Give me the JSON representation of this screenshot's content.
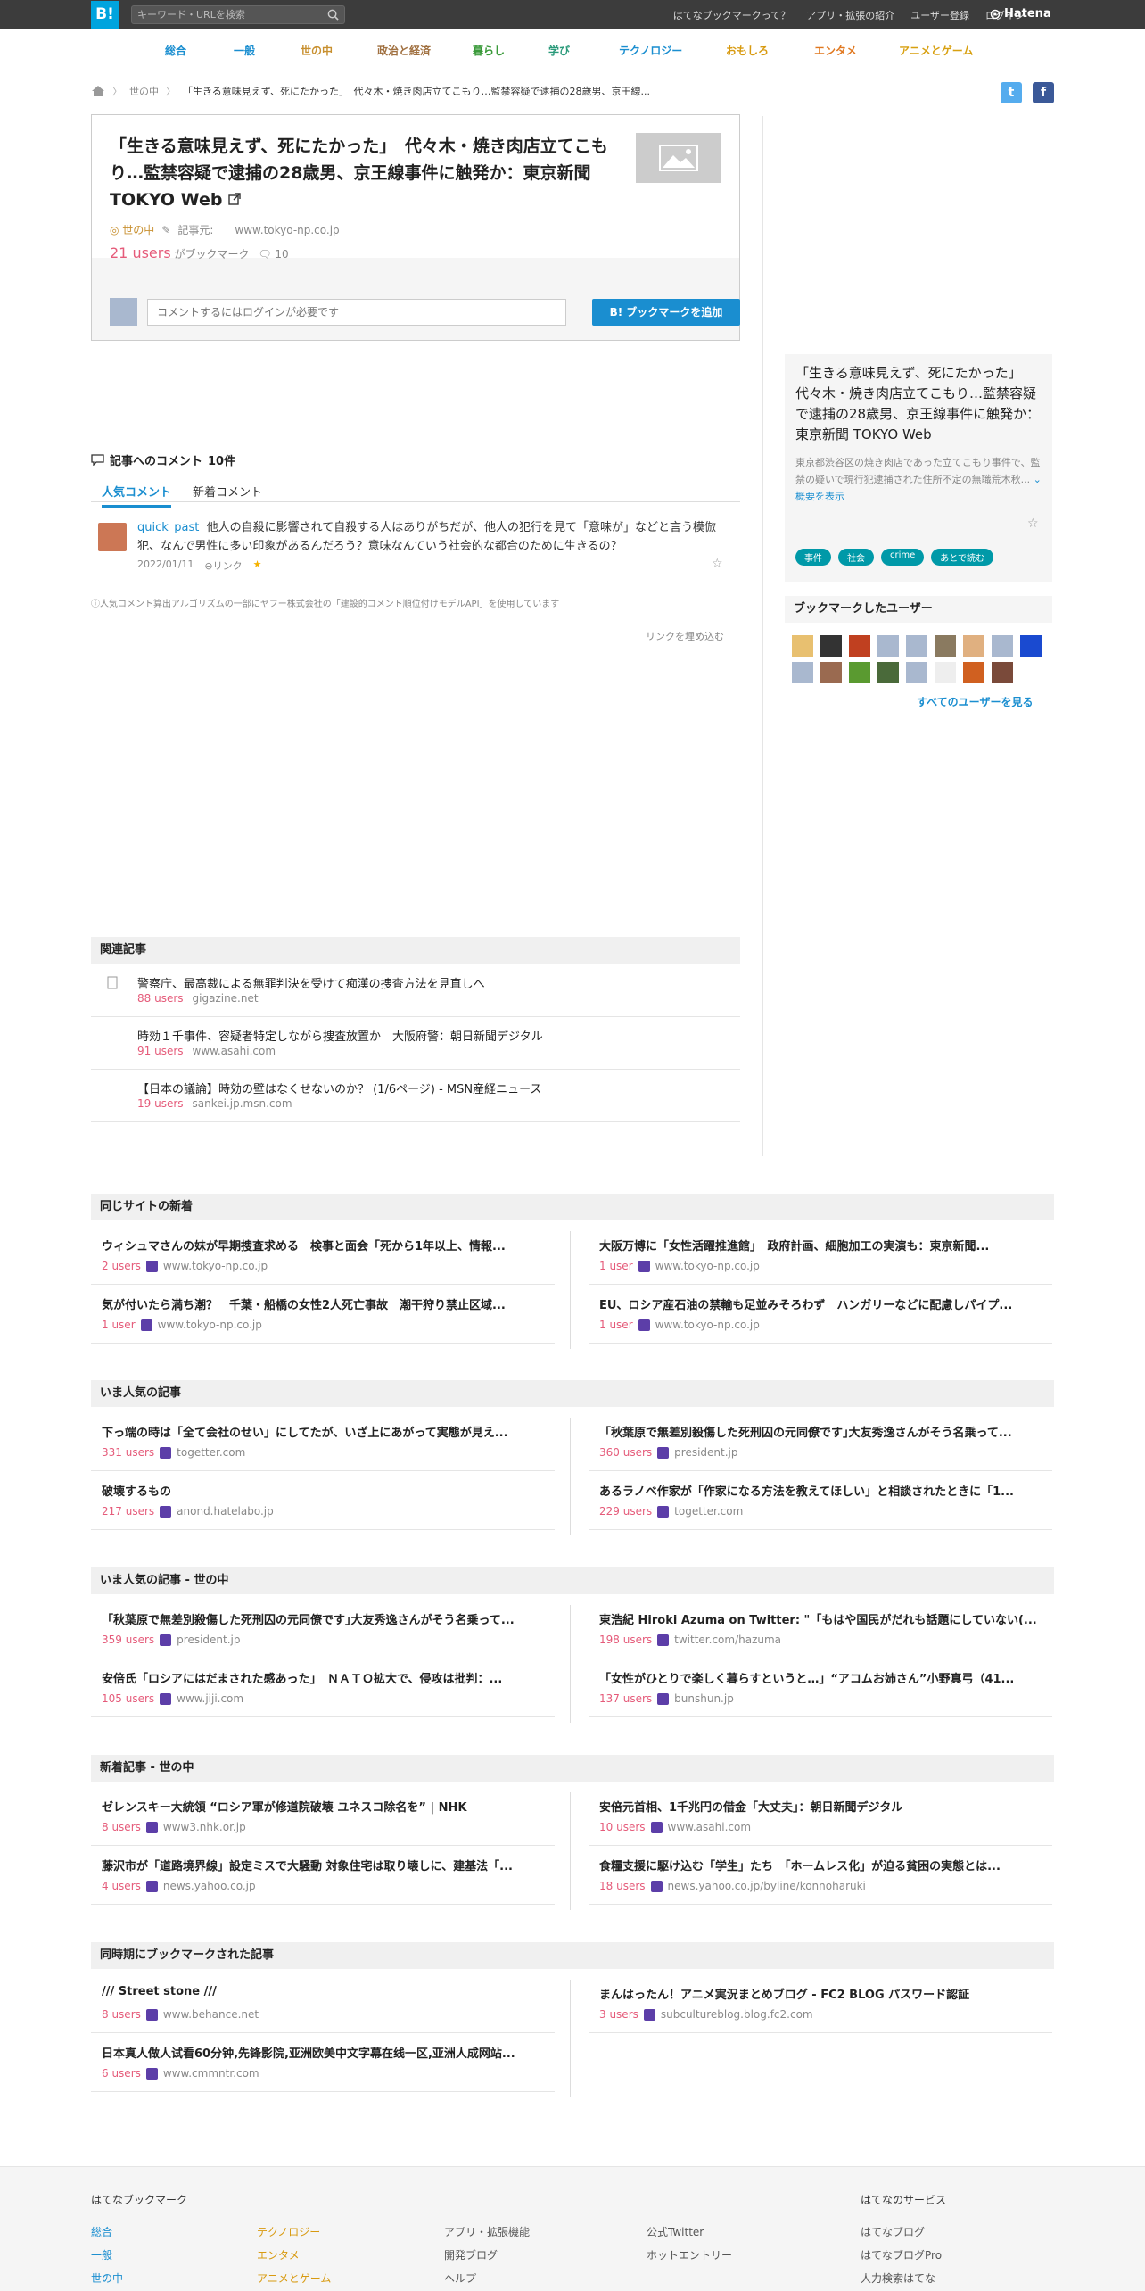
{
  "header": {
    "logo": "B!",
    "search_placeholder": "キーワード・URLを検索",
    "nav": [
      "はてなブックマークって？",
      "アプリ・拡張の紹介",
      "ユーザー登録",
      "ログイン"
    ],
    "hatena": "Hatena"
  },
  "categories": [
    {
      "label": "総合",
      "color": "#1a8ed0"
    },
    {
      "label": "一般",
      "color": "#1a8ed0"
    },
    {
      "label": "世の中",
      "color": "#c89030"
    },
    {
      "label": "政治と経済",
      "color": "#a07040"
    },
    {
      "label": "暮らし",
      "color": "#3a9a3a"
    },
    {
      "label": "学び",
      "color": "#2a9a7a"
    },
    {
      "label": "テクノロジー",
      "color": "#1a8ed0"
    },
    {
      "label": "おもしろ",
      "color": "#d89a10"
    },
    {
      "label": "エンタメ",
      "color": "#e07820"
    },
    {
      "label": "アニメとゲーム",
      "color": "#d8a010"
    }
  ],
  "breadcrumb": {
    "category": "世の中",
    "current": "「生きる意味見えず、死にたかった」　代々木・焼き肉店立てこもり…監禁容疑で逮捕の28歳男、京王線..."
  },
  "entry": {
    "title": "「生きる意味見えず、死にたかった」　代々木・焼き肉店立てこもり…監禁容疑で逮捕の28歳男、京王線事件に触発か：東京新聞 TOKYO Web",
    "category": "世の中",
    "kiji_label": "記事元:",
    "domain": "www.tokyo-np.co.jp",
    "users_count": "21 users",
    "users_suffix": "がブックマーク",
    "comment_count": "10",
    "comment_placeholder": "コメントするにはログインが必要です",
    "add_button": "ブックマークを追加"
  },
  "sidebar": {
    "summary_title": "「生きる意味見えず、死にたかった」　代々木・焼き肉店立てこもり…監禁容疑で逮捕の28歳男、京王線事件に触発か：東京新聞 TOKYO Web",
    "summary_desc": "東京都渋谷区の焼き肉店であった立てこもり事件で、監禁の疑いで現行犯逮捕された住所不定の無職荒木秋...",
    "show_summary": "概要を表示",
    "tags": [
      "事件",
      "社会",
      "crime",
      "あとで読む"
    ],
    "bookmark_users_title": "ブックマークしたユーザー",
    "all_users": "すべてのユーザーを見る"
  },
  "comments": {
    "heading": "記事へのコメント",
    "count": "10件",
    "tab_popular": "人気コメント",
    "tab_new": "新着コメント",
    "items": [
      {
        "user": "quick_past",
        "text": "他人の自殺に影響されて自殺する人はありがちだが、他人の犯行を見て「意味が」などと言う模倣犯、なんで男性に多い印象があるんだろう？意味なんていう社会的な都合のために生きるの？",
        "date": "2022/01/11",
        "link": "リンク"
      }
    ],
    "note": "人気コメント算出アルゴリズムの一部にヤフー株式会社の「建設的コメント順位付けモデルAPI」を使用しています",
    "embed": "リンクを埋め込む"
  },
  "related": {
    "title": "関連記事",
    "items": [
      {
        "title": "警察庁、最高裁による無罪判決を受けて痴漢の捜査方法を見直しへ",
        "users": "88 users",
        "domain": "gigazine.net"
      },
      {
        "title": "時効１千事件、容疑者特定しながら捜査放置か　大阪府警：朝日新聞デジタル",
        "users": "91 users",
        "domain": "www.asahi.com"
      },
      {
        "title": "【日本の議論】時効の壁はなくせないのか？ (1/6ページ) - MSN産経ニュース",
        "users": "19 users",
        "domain": "sankei.jp.msn.com"
      }
    ]
  },
  "sections": [
    {
      "title": "同じサイトの新着",
      "items": [
        {
          "title": "ウィシュマさんの妹が早期捜査求める　検事と面会「死から1年以上、情報...",
          "users": "2 users",
          "domain": "www.tokyo-np.co.jp"
        },
        {
          "title": "大阪万博に「女性活躍推進館」　政府計画、細胞加工の実演も：東京新聞...",
          "users": "1 user",
          "domain": "www.tokyo-np.co.jp"
        },
        {
          "title": "気が付いたら満ち潮？　千葉・船橋の女性2人死亡事故　潮干狩り禁止区域...",
          "users": "1 user",
          "domain": "www.tokyo-np.co.jp"
        },
        {
          "title": "EU、ロシア産石油の禁輸も足並みそろわず　ハンガリーなどに配慮しパイプ...",
          "users": "1 user",
          "domain": "www.tokyo-np.co.jp"
        }
      ]
    },
    {
      "title": "いま人気の記事",
      "items": [
        {
          "title": "下っ端の時は「全て会社のせい」にしてたが、いざ上にあがって実態が見え...",
          "users": "331 users",
          "domain": "togetter.com"
        },
        {
          "title": "「秋葉原で無差別殺傷した死刑囚の元同僚です｣大友秀逸さんがそう名乗って...",
          "users": "360 users",
          "domain": "president.jp"
        },
        {
          "title": "破壊するもの",
          "users": "217 users",
          "domain": "anond.hatelabo.jp"
        },
        {
          "title": "あるラノベ作家が「作家になる方法を教えてほしい」と相談されたときに「1...",
          "users": "229 users",
          "domain": "togetter.com"
        }
      ]
    },
    {
      "title": "いま人気の記事 - 世の中",
      "items": [
        {
          "title": "「秋葉原で無差別殺傷した死刑囚の元同僚です｣大友秀逸さんがそう名乗って...",
          "users": "359 users",
          "domain": "president.jp"
        },
        {
          "title": "東浩紀 Hiroki Azuma on Twitter: \"「もはや国民がだれも話題にしていない(...",
          "users": "198 users",
          "domain": "twitter.com/hazuma"
        },
        {
          "title": "安倍氏「ロシアにはだまされた感あった」　ＮＡＴＯ拡大で、侵攻は批判：...",
          "users": "105 users",
          "domain": "www.jiji.com"
        },
        {
          "title": "「女性がひとりで楽しく暮らすというと…」“アコムお姉さん”小野真弓（41...",
          "users": "137 users",
          "domain": "bunshun.jp"
        }
      ]
    },
    {
      "title": "新着記事 - 世の中",
      "items": [
        {
          "title": "ゼレンスキー大統領 “ロシア軍が修道院破壊 ユネスコ除名を” | NHK",
          "users": "8 users",
          "domain": "www3.nhk.or.jp"
        },
        {
          "title": "安倍元首相、1千兆円の借金「大丈夫」：朝日新聞デジタル",
          "users": "10 users",
          "domain": "www.asahi.com"
        },
        {
          "title": "藤沢市が「道路境界線」設定ミスで大騒動 対象住宅は取り壊しに、建基法「...",
          "users": "4 users",
          "domain": "news.yahoo.co.jp"
        },
        {
          "title": "食糧支援に駆け込む「学生」たち　「ホームレス化」が迫る貧困の実態とは...",
          "users": "18 users",
          "domain": "news.yahoo.co.jp/byline/konnoharuki"
        }
      ]
    },
    {
      "title": "同時期にブックマークされた記事",
      "items": [
        {
          "title": "/// Street stone ///",
          "users": "8 users",
          "domain": "www.behance.net"
        },
        {
          "title": "まんはったん！アニメ実況まとめブログ - FC2 BLOG パスワード認証",
          "users": "3 users",
          "domain": "subcultureblog.blog.fc2.com"
        },
        {
          "title": "日本真人做人试看60分钟,先锋影院,亚洲欧美中文字幕在线一区,亚洲人成网站...",
          "users": "6 users",
          "domain": "www.cmmntr.com"
        }
      ]
    }
  ],
  "footer": {
    "brand": "はてなブックマーク",
    "col1": [
      "総合",
      "一般",
      "世の中"
    ],
    "col2": [
      "テクノロジー",
      "エンタメ",
      "アニメとゲーム"
    ],
    "col3": [
      "アプリ・拡張機能",
      "開発ブログ",
      "ヘルプ"
    ],
    "col4": [
      "公式Twitter",
      "ホットエントリー"
    ],
    "services_title": "はてなのサービス",
    "services": [
      "はてなブログ",
      "はてなブログPro",
      "人力検索はてな"
    ]
  }
}
